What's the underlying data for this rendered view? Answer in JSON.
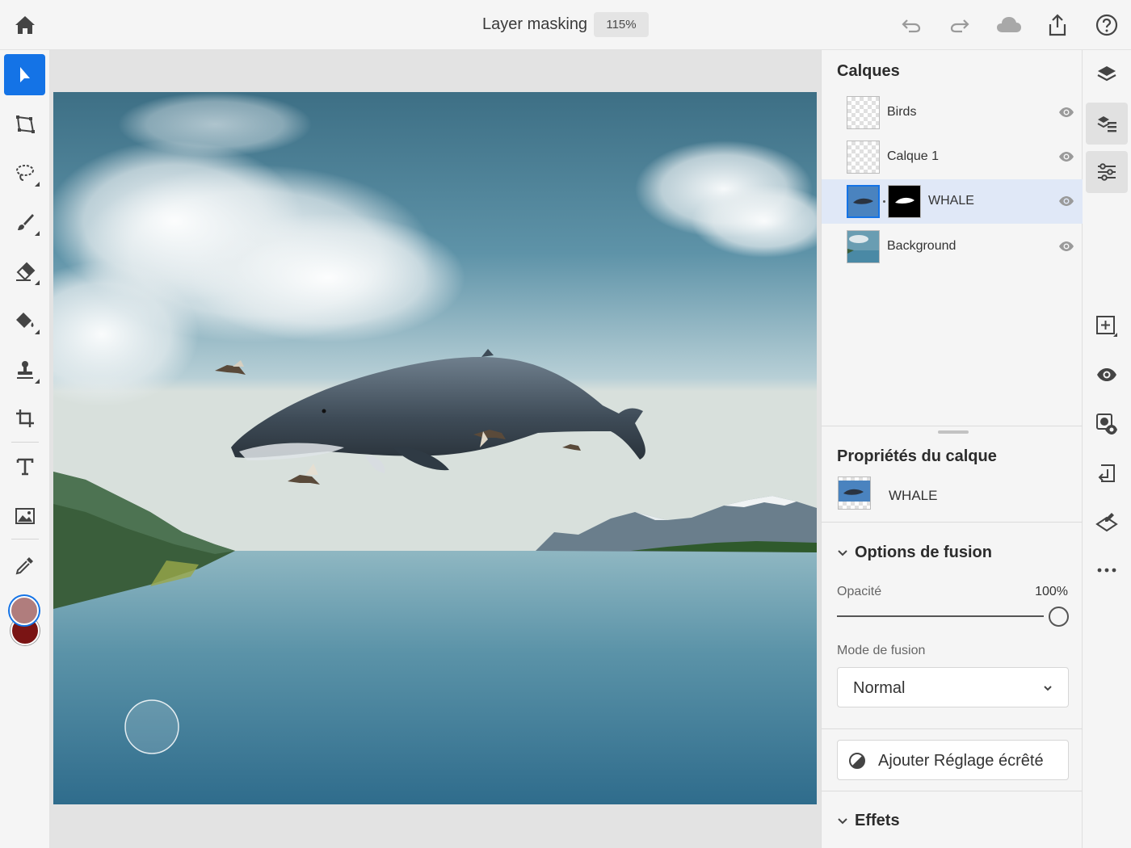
{
  "document": {
    "title": "Layer masking",
    "zoom": "115%"
  },
  "colors": {
    "accent": "#1473e6",
    "foreground_color": "#b07d7d",
    "background_color": "#7a1414",
    "selected_row": "#e0e8f7"
  },
  "toolbar_icons": [
    "home-icon",
    "undo-icon",
    "redo-icon",
    "cloud-icon",
    "share-icon",
    "help-icon"
  ],
  "tools": [
    "select-tool",
    "transform-tool",
    "lasso-tool",
    "brush-tool",
    "eraser-tool",
    "fill-tool",
    "clone-stamp-tool",
    "crop-tool",
    "type-tool",
    "place-image-tool",
    "eyedropper-tool"
  ],
  "layers_panel": {
    "title": "Calques",
    "layers": [
      {
        "name": "Birds",
        "visible": true,
        "selected": false
      },
      {
        "name": "Calque 1",
        "visible": true,
        "selected": false
      },
      {
        "name": "WHALE",
        "visible": true,
        "selected": true,
        "has_mask": true
      },
      {
        "name": "Background",
        "visible": true,
        "selected": false
      }
    ]
  },
  "properties": {
    "title": "Propriétés du calque",
    "layer_name": "WHALE",
    "blend_section": "Options de fusion",
    "opacity_label": "Opacité",
    "opacity_value": "100%",
    "opacity_fraction": 1.0,
    "blend_mode_label": "Mode de fusion",
    "blend_mode_value": "Normal",
    "clip_button": "Ajouter Réglage écrêté",
    "effects_section": "Effets"
  },
  "rail_icons": [
    "layers-icon",
    "layer-list-icon",
    "adjustments-icon",
    "add-layer-icon",
    "visibility-icon",
    "mask-icon",
    "import-icon",
    "erase-layer-icon",
    "more-icon"
  ]
}
